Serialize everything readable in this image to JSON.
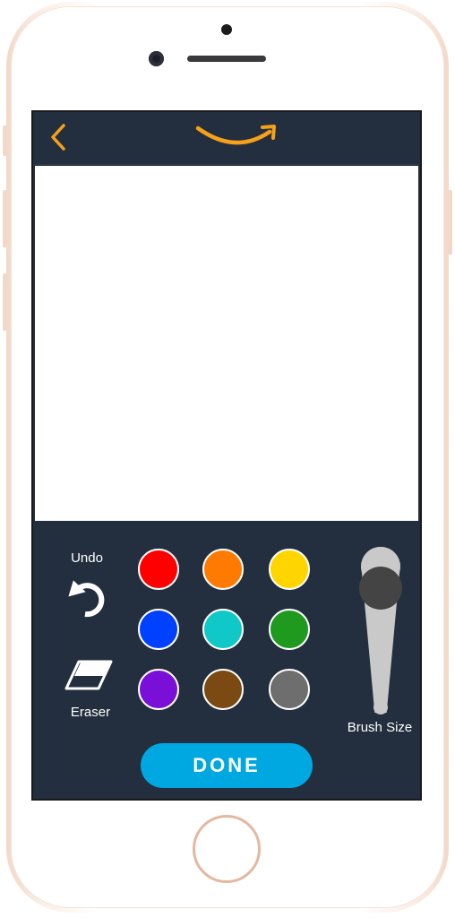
{
  "header": {
    "back_icon": "chevron-left-icon",
    "logo_icon": "amazon-smile-logo-icon",
    "accent_color": "#f7a11a"
  },
  "tools": {
    "undo_label": "Undo",
    "eraser_label": "Eraser",
    "brush_size_label": "Brush Size",
    "done_label": "DONE"
  },
  "palette": [
    {
      "name": "red",
      "color": "#ff0000"
    },
    {
      "name": "orange",
      "color": "#ff7a00"
    },
    {
      "name": "yellow",
      "color": "#ffd500"
    },
    {
      "name": "blue",
      "color": "#0040ff"
    },
    {
      "name": "teal",
      "color": "#10c8c8"
    },
    {
      "name": "green",
      "color": "#1f9a1f"
    },
    {
      "name": "purple",
      "color": "#7a10d8"
    },
    {
      "name": "brown",
      "color": "#7a4a12"
    },
    {
      "name": "gray",
      "color": "#6e6e6e"
    }
  ],
  "brush_size_level": 0.16,
  "colors": {
    "screen_bg": "#232f3e",
    "done_button": "#00a8e1",
    "slider_track": "#c9c9c9",
    "slider_knob": "#444444"
  }
}
